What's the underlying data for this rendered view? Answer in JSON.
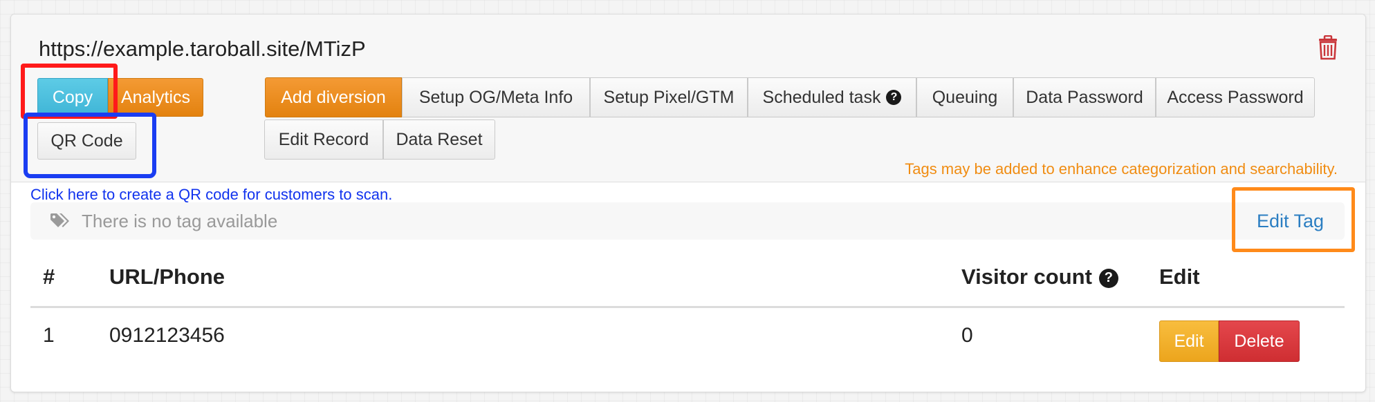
{
  "link": {
    "url": "https://example.taroball.site/MTizP",
    "delete_icon": "trash-icon"
  },
  "left_buttons": {
    "copy": "Copy",
    "analytics": "Analytics",
    "qr_code": "QR Code"
  },
  "toolbar": {
    "row1": [
      {
        "label": "Add diversion",
        "name": "add-diversion-button",
        "primary": true,
        "help": false
      },
      {
        "label": "Setup OG/Meta Info",
        "name": "setup-og-meta-button",
        "primary": false,
        "help": false
      },
      {
        "label": "Setup Pixel/GTM",
        "name": "setup-pixel-gtm-button",
        "primary": false,
        "help": false
      },
      {
        "label": "Scheduled task",
        "name": "scheduled-task-button",
        "primary": false,
        "help": true
      },
      {
        "label": "Queuing",
        "name": "queuing-button",
        "primary": false,
        "help": false
      },
      {
        "label": "Data Password",
        "name": "data-password-button",
        "primary": false,
        "help": false
      },
      {
        "label": "Access Password",
        "name": "access-password-button",
        "primary": false,
        "help": false
      }
    ],
    "row2": [
      {
        "label": "Edit Record",
        "name": "edit-record-button",
        "primary": false,
        "help": false
      },
      {
        "label": "Data Reset",
        "name": "data-reset-button",
        "primary": false,
        "help": false
      }
    ],
    "help_glyph": "?"
  },
  "annotations": {
    "tags_hint": "Tags may be added to enhance categorization and searchability.",
    "qr_hint": "Click here to create a QR code for customers to scan."
  },
  "tags": {
    "icon": "tags-icon",
    "empty_text": "There is no tag available",
    "edit_label": "Edit Tag"
  },
  "table": {
    "headers": {
      "index": "#",
      "url": "URL/Phone",
      "visitors": "Visitor count",
      "edit": "Edit"
    },
    "rows": [
      {
        "index": "1",
        "url": "0912123456",
        "visitors": "0",
        "edit_label": "Edit",
        "delete_label": "Delete"
      }
    ]
  },
  "colors": {
    "copy": "#43b8d9",
    "analytics_orange": "#e9880f",
    "delete_red": "#d33236",
    "edit_yellow": "#f0ae28",
    "link_blue": "#2b7ec2",
    "tag_hint_orange": "#f08c12",
    "qr_hint_blue": "#1133ee",
    "highlight_red": "#ff1a1a",
    "highlight_blue": "#1a3df2",
    "highlight_orange": "#ff8a1a"
  }
}
